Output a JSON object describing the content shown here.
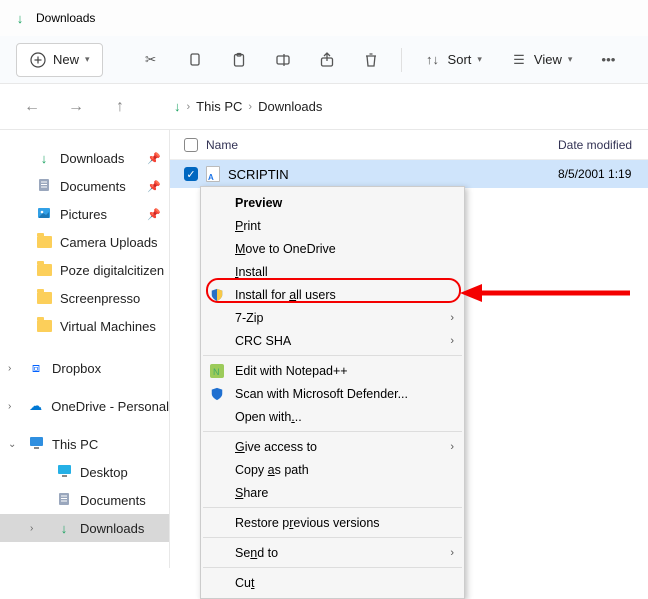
{
  "titlebar": {
    "title": "Downloads"
  },
  "toolbar": {
    "new_label": "New",
    "sort_label": "Sort",
    "view_label": "View"
  },
  "breadcrumb": {
    "root": "This PC",
    "current": "Downloads"
  },
  "sidebar": {
    "quick": [
      {
        "label": "Downloads",
        "pinned": true,
        "icon": "download"
      },
      {
        "label": "Documents",
        "pinned": true,
        "icon": "document"
      },
      {
        "label": "Pictures",
        "pinned": true,
        "icon": "pictures"
      },
      {
        "label": "Camera Uploads",
        "pinned": false,
        "icon": "folder"
      },
      {
        "label": "Poze digitalcitizen",
        "pinned": false,
        "icon": "folder"
      },
      {
        "label": "Screenpresso",
        "pinned": false,
        "icon": "folder"
      },
      {
        "label": "Virtual Machines",
        "pinned": false,
        "icon": "folder"
      }
    ],
    "groups": [
      {
        "label": "Dropbox",
        "icon": "dropbox",
        "expanded": false
      },
      {
        "label": "OneDrive - Personal",
        "icon": "onedrive",
        "expanded": false
      },
      {
        "label": "This PC",
        "icon": "thispc",
        "expanded": true,
        "children": [
          {
            "label": "Desktop",
            "icon": "desktop"
          },
          {
            "label": "Documents",
            "icon": "document"
          },
          {
            "label": "Downloads",
            "icon": "download",
            "active": true
          }
        ]
      }
    ]
  },
  "columns": {
    "name": "Name",
    "date": "Date modified"
  },
  "file": {
    "name": "SCRIPTIN",
    "date": "8/5/2001 1:19"
  },
  "context_menu": {
    "items": [
      {
        "label": "Preview",
        "bold": true,
        "accel": ""
      },
      {
        "label": "Print",
        "underline": 0
      },
      {
        "label": "Move to OneDrive",
        "underline": 0
      },
      {
        "label": "Install",
        "underline": 0
      },
      {
        "label": "Install for all users",
        "underline": 12,
        "icon": "shield",
        "highlighted": true
      },
      {
        "label": "7-Zip",
        "submenu": true
      },
      {
        "label": "CRC SHA",
        "submenu": true
      },
      {
        "separator": true
      },
      {
        "label": "Edit with Notepad++",
        "icon": "notepadpp"
      },
      {
        "label": "Scan with Microsoft Defender...",
        "icon": "defender"
      },
      {
        "label": "Open with...",
        "underline": 9
      },
      {
        "separator": true
      },
      {
        "label": "Give access to",
        "underline": 0,
        "submenu": true
      },
      {
        "label": "Copy as path",
        "underline": 5
      },
      {
        "label": "Share",
        "underline": 0
      },
      {
        "separator": true
      },
      {
        "label": "Restore previous versions",
        "underline": 9
      },
      {
        "separator": true
      },
      {
        "label": "Send to",
        "underline": 2,
        "submenu": true
      },
      {
        "separator": true
      },
      {
        "label": "Cut",
        "underline": 2
      }
    ]
  }
}
